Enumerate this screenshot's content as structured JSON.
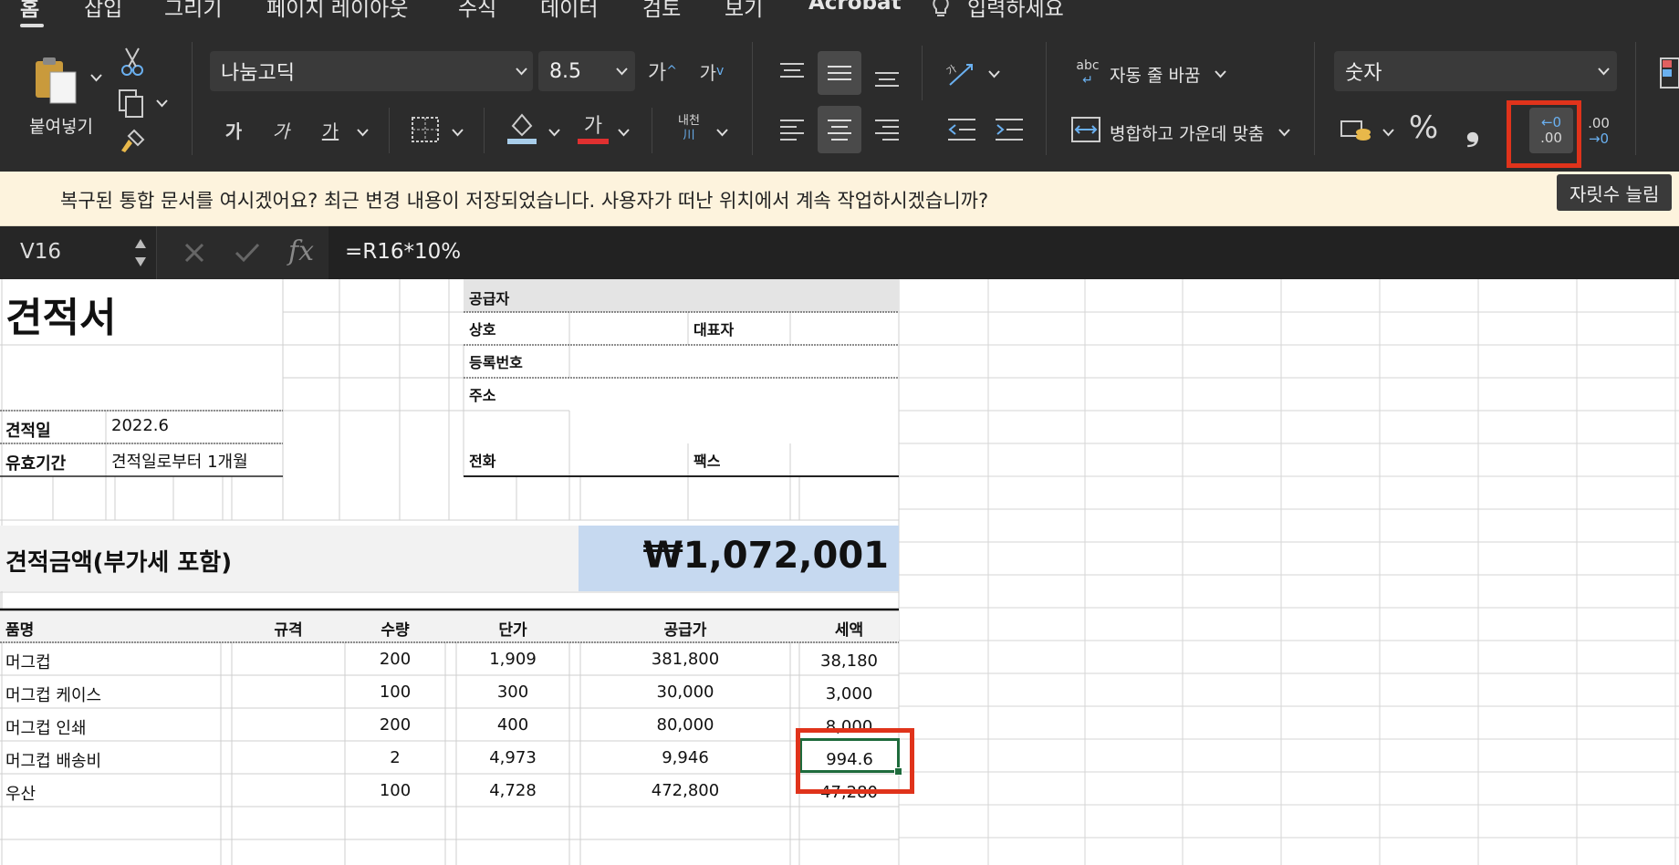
{
  "ribbon": {
    "tabs": [
      "홈",
      "삽입",
      "그리기",
      "페이지 레이아웃",
      "수식",
      "데이터",
      "검토",
      "보기",
      "Acrobat"
    ],
    "tellme": "입력하세요",
    "paste_label": "붙여넣기",
    "font_name": "나눔고딕",
    "font_size": "8.5",
    "grow_font": "가",
    "shrink_font": "가",
    "bold": "가",
    "italic": "가",
    "underline": "가",
    "font_color_glyph": "가",
    "phonetic_glyph_top": "내천",
    "phonetic_glyph_bottom": "川",
    "wrap_text_abc": "abc",
    "wrap_text_label": "자동 줄 바꿈",
    "merge_center_label": "병합하고 가운데 맞춤",
    "number_format": "숫자",
    "percent": "%",
    "comma": "❟",
    "inc_decimal_top": "←0",
    "inc_decimal_bottom": ".00",
    "dec_decimal_top": ".00",
    "dec_decimal_bottom": "→0",
    "accent_red": "#e0331b",
    "fill_color": "#a8cdea",
    "font_color": "#e03030"
  },
  "infobar": {
    "text": "복구된 통합 문서를 여시겠어요?  최근 변경 내용이 저장되었습니다. 사용자가 떠난 위치에서 계속 작업하시겠습니까?"
  },
  "tooltip": "자릿수 늘림",
  "formula_bar": {
    "name_box": "V16",
    "fx": "fx",
    "formula": "=R16*10%"
  },
  "sheet": {
    "title": "견적서",
    "quote_date_label": "견적일",
    "quote_date": "2022.6",
    "validity_label": "유효기간",
    "validity": "견적일로부터 1개월",
    "supplier_header": "공급자",
    "company_label": "상호",
    "ceo_label": "대표자",
    "reg_no_label": "등록번호",
    "address_label": "주소",
    "phone_label": "전화",
    "fax_label": "팩스",
    "total_label": "견적금액(부가세 포함)",
    "total_value": "₩1,072,001",
    "total_bg": "#c6d9f0",
    "table_headers": [
      "품명",
      "규격",
      "수량",
      "단가",
      "공급가",
      "세액"
    ],
    "rows": [
      {
        "name": "머그컵",
        "spec": "",
        "qty": "200",
        "price": "1,909",
        "supply": "381,800",
        "tax": "38,180"
      },
      {
        "name": "머그컵 케이스",
        "spec": "",
        "qty": "100",
        "price": "300",
        "supply": "30,000",
        "tax": "3,000"
      },
      {
        "name": "머그컵 인쇄",
        "spec": "",
        "qty": "200",
        "price": "400",
        "supply": "80,000",
        "tax": "8,000"
      },
      {
        "name": "머그컵 배송비",
        "spec": "",
        "qty": "2",
        "price": "4,973",
        "supply": "9,946",
        "tax": "994.6"
      },
      {
        "name": "우산",
        "spec": "",
        "qty": "100",
        "price": "4,728",
        "supply": "472,800",
        "tax": "47,280"
      }
    ]
  }
}
